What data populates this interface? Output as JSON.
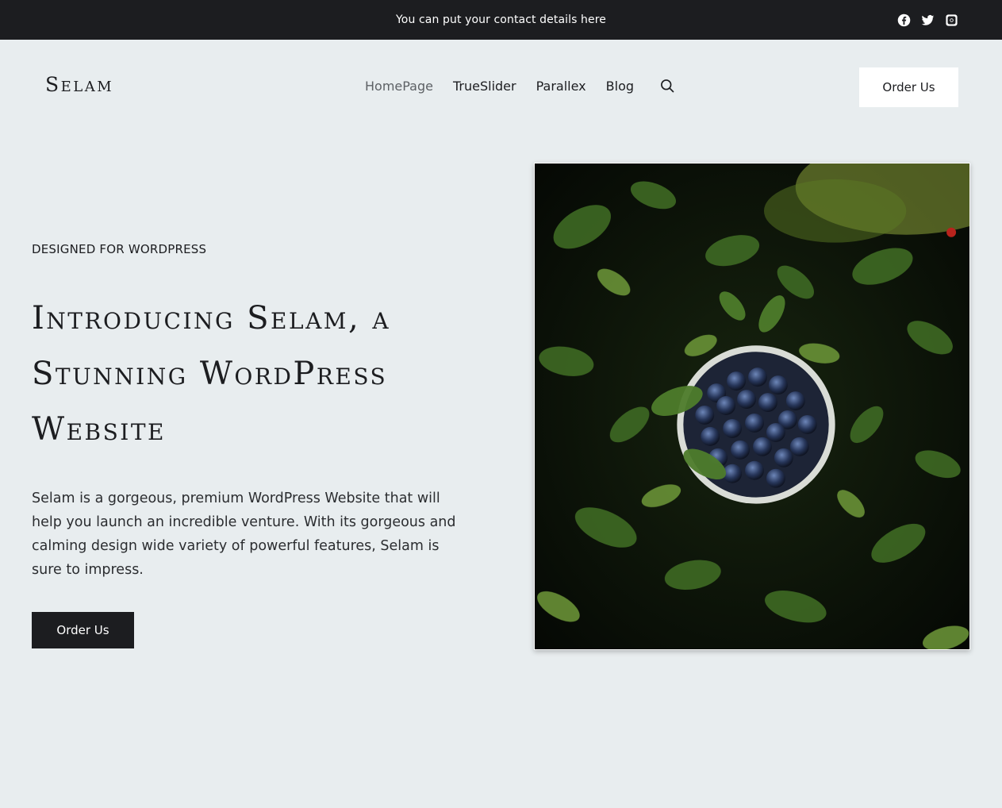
{
  "topbar": {
    "contact_text": "You can put your contact details here",
    "social_icons": [
      "facebook-icon",
      "twitter-icon",
      "instagram-icon"
    ]
  },
  "header": {
    "logo": "Selam",
    "nav": [
      {
        "label": "HomePage",
        "active": true
      },
      {
        "label": "TrueSlider",
        "active": false
      },
      {
        "label": "Parallex",
        "active": false
      },
      {
        "label": "Blog",
        "active": false
      }
    ],
    "search_icon": "search-icon",
    "order_button": "Order Us"
  },
  "hero": {
    "eyebrow": "DESIGNED FOR WORDPRESS",
    "title": "Introducing Selam, a Stunning WordPress Website",
    "description": "Selam is a gorgeous, premium WordPress Website that will help you launch an incredible venture. With its gorgeous and calming design  wide variety of powerful features, Selam is sure to impress.",
    "order_button": "Order Us",
    "image": "blueberries-in-bowl-among-leaves-photo"
  },
  "colors": {
    "background": "#e8edef",
    "topbar": "#1c1d20",
    "text": "#1c1d20",
    "button_dark": "#1c1d20",
    "button_light": "#ffffff"
  }
}
